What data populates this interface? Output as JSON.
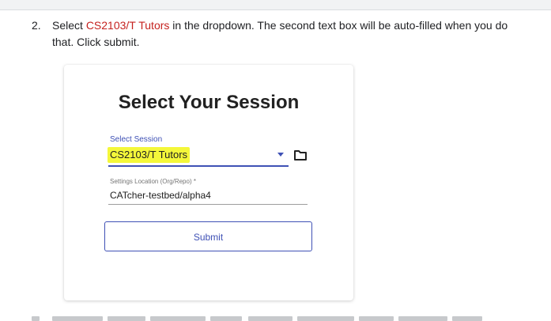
{
  "instruction": {
    "number": "2.",
    "before": "Select ",
    "highlight": "CS2103/T Tutors",
    "after": " in the dropdown. The second text box will be auto-filled when you do that. Click submit."
  },
  "card": {
    "title": "Select Your Session",
    "session_field": {
      "label": "Select Session",
      "value": "CS2103/T Tutors"
    },
    "settings_field": {
      "label": "Settings Location (Org/Repo) *",
      "value": "CATcher-testbed/alpha4"
    },
    "submit_label": "Submit"
  },
  "colors": {
    "accent": "#3f51b5",
    "highlight": "#f4f73a",
    "instruction_highlight": "#c5221f"
  },
  "icons": {
    "dropdown": "caret-down-icon",
    "folder": "folder-icon"
  }
}
